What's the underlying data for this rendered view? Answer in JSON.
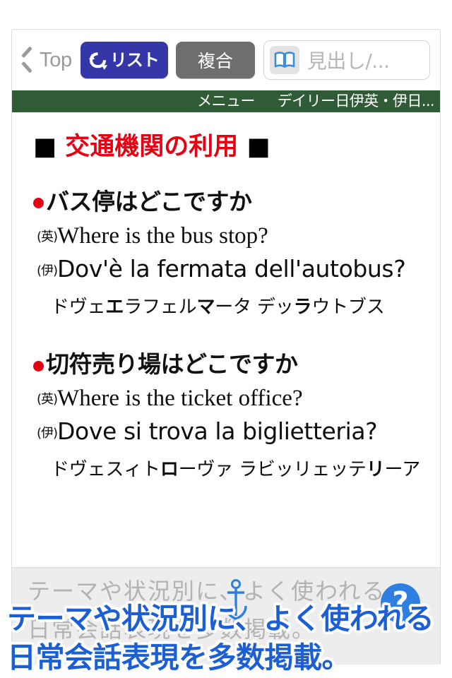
{
  "toolbar": {
    "back_label": "Top",
    "back_icon": "chevron-left-icon",
    "list_button_label": "リスト",
    "list_button_icon": "loop-arrow-icon",
    "list_button_color": "#3537a8",
    "compound_button_label": "複合",
    "compound_button_color": "#6e6e6e",
    "search_icon": "book-icon",
    "search_icon_color": "#3a8ddb",
    "search_value": "",
    "search_placeholder": "見出し/..."
  },
  "green_bar": {
    "background": "#2f5b36",
    "menu_label": "メニュー",
    "dictionary_label": "デイリー日伊英・伊日..."
  },
  "content": {
    "section_heading": "交通機関の利用",
    "heading_marker": "■",
    "heading_color": "#e60012",
    "bullet_color": "#e60012",
    "entries": [
      {
        "headword": "バス停はどこですか",
        "english_tag": "(英)",
        "english": "Where is the bus stop?",
        "italian_tag": "(伊)",
        "italian": "Dov'è la fermata dell'autobus?",
        "pronunciation_parts": [
          {
            "text": "ドヴ",
            "bold": false
          },
          {
            "text": "ェ",
            "bold": false
          },
          {
            "text": "エ",
            "bold": true
          },
          {
            "text": "ラフェル",
            "bold": false
          },
          {
            "text": "マ",
            "bold": true
          },
          {
            "text": "ータ デッ",
            "bold": false
          },
          {
            "text": "ラ",
            "bold": true
          },
          {
            "text": "ウトブス",
            "bold": false
          }
        ]
      },
      {
        "headword": "切符売り場はどこですか",
        "english_tag": "(英)",
        "english": "Where is the ticket office?",
        "italian_tag": "(伊)",
        "italian": "Dove si trova la biglietteria?",
        "pronunciation_parts": [
          {
            "text": "ドヴェスィト",
            "bold": false
          },
          {
            "text": "ロ",
            "bold": true
          },
          {
            "text": "ーヴァ ラビッリェッテ",
            "bold": false
          },
          {
            "text": "リ",
            "bold": true
          },
          {
            "text": "ーア",
            "bold": false
          }
        ]
      }
    ]
  },
  "bottom_strip": {
    "ghost_line_1": "テーマや状況別に、よく使われる",
    "ghost_line_2": "日常会話表現を多数掲載。",
    "help_icon": "question-mark-icon",
    "help_icon_color": "#2f7fe0",
    "anchor_icon": "anchor-icon"
  },
  "caption_overlay": {
    "line1": "テーマや状況別に、よく使われる",
    "line2": "日常会話表現を多数掲載。",
    "color": "#1c5fd4",
    "outline": "#ffffff"
  }
}
